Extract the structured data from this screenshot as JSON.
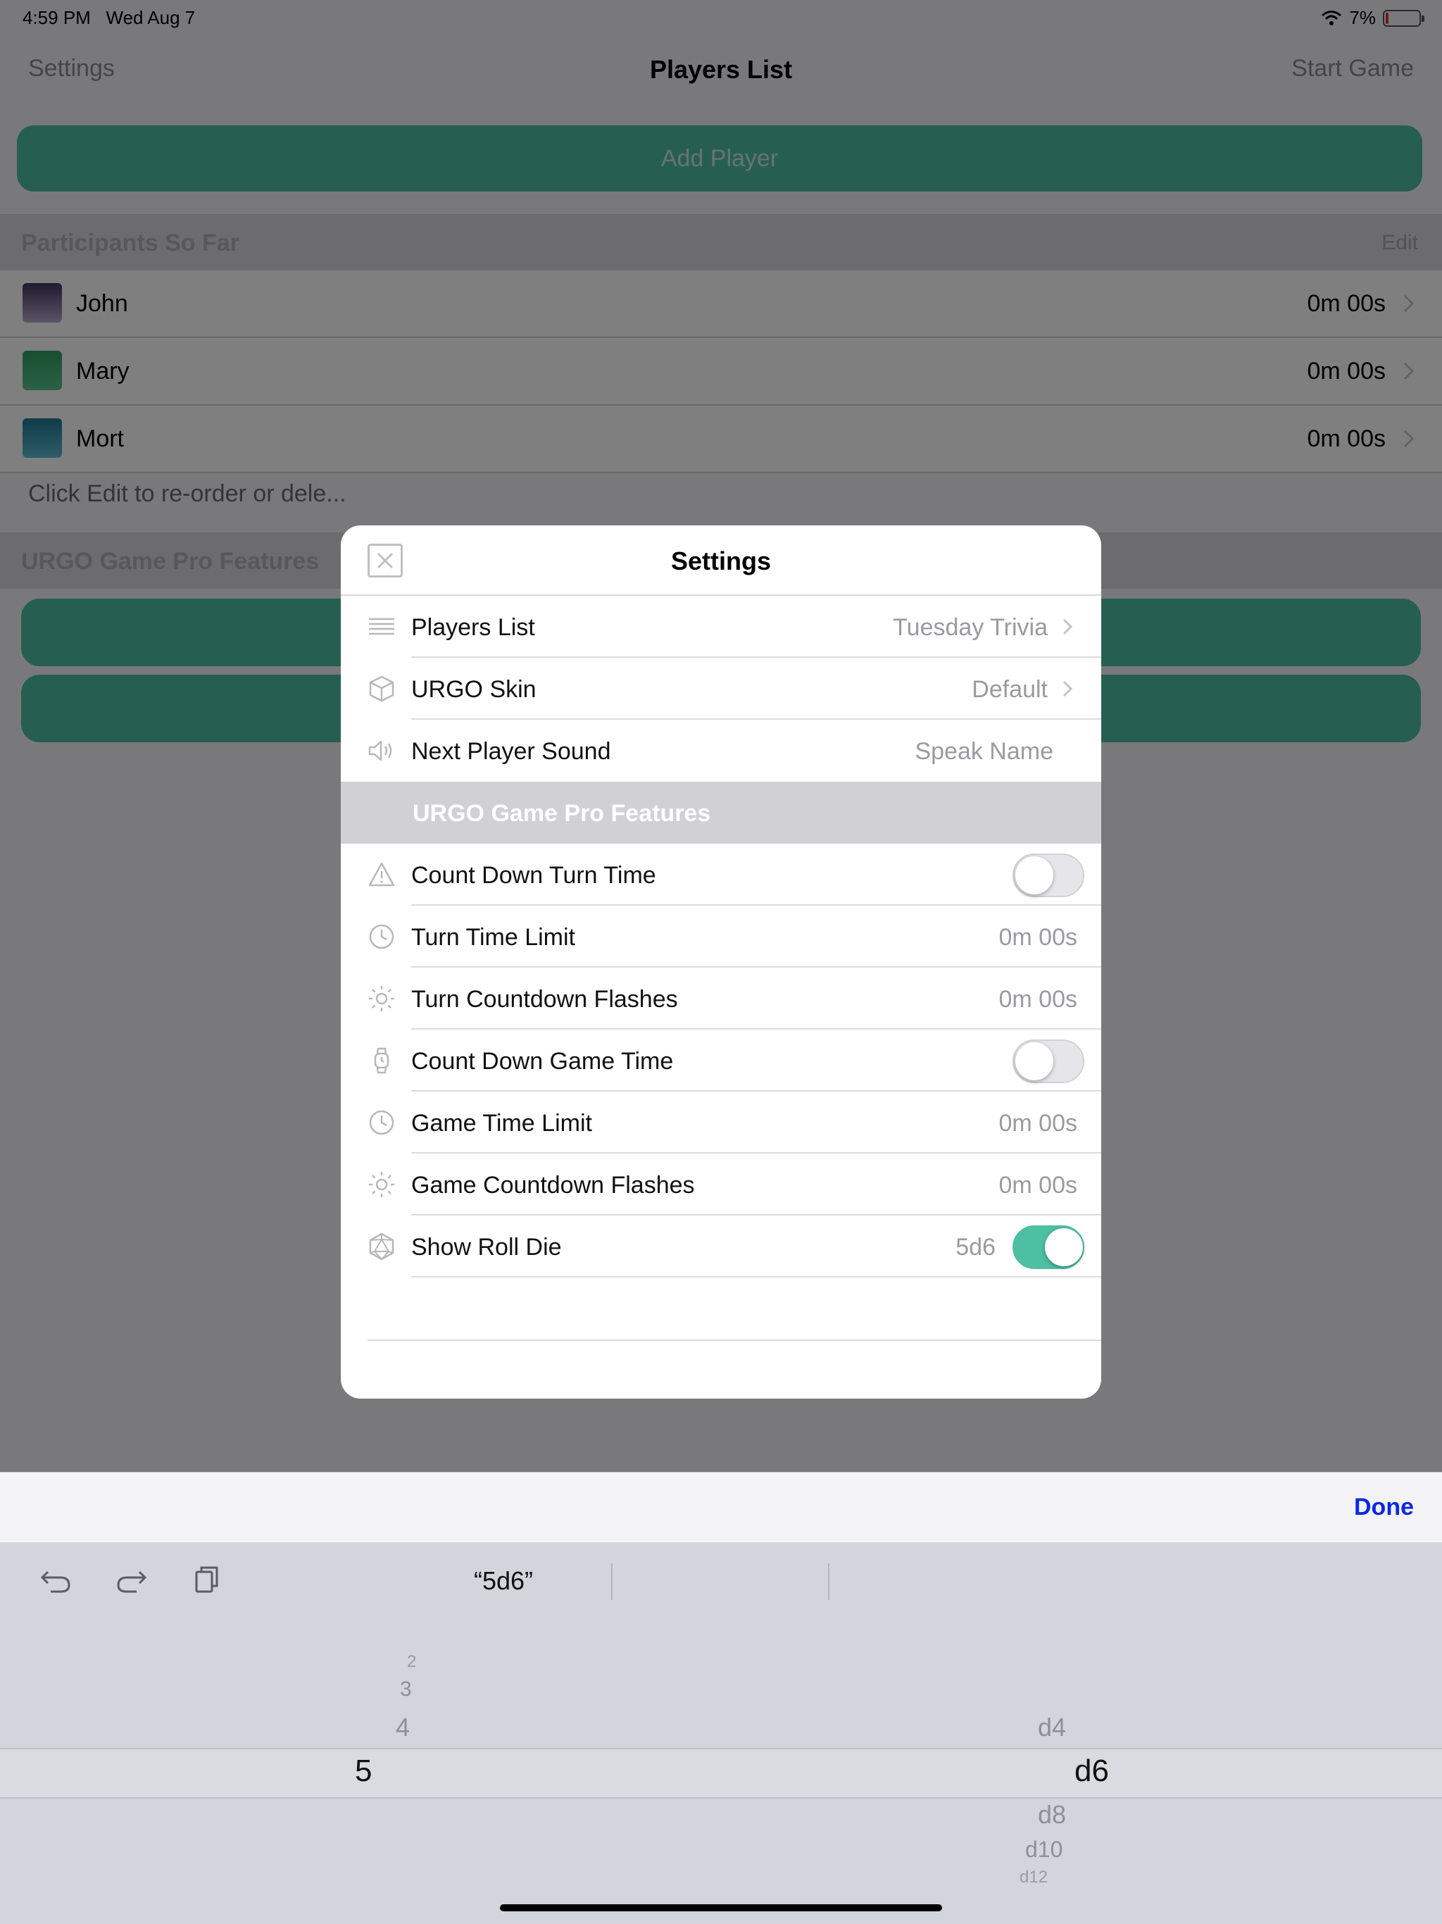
{
  "status_bar": {
    "time": "4:59 PM",
    "date": "Wed Aug 7",
    "battery": "7%"
  },
  "navbar": {
    "left": "Settings",
    "title": "Players List",
    "right": "Start Game"
  },
  "add_player_label": "Add Player",
  "participants": {
    "header": "Participants So Far",
    "edit_label": "Edit",
    "players": [
      {
        "name": "John",
        "time": "0m 00s",
        "color": "#5b4a7a"
      },
      {
        "name": "Mary",
        "time": "0m 00s",
        "color": "#3fae72"
      },
      {
        "name": "Mort",
        "time": "0m 00s",
        "color": "#2f8fa8"
      }
    ],
    "hint": "Click Edit to re-order or dele..."
  },
  "pro_section_title": "URGO Game Pro Features",
  "colors": {
    "accent": "#4dbfa3",
    "done_blue": "#0a28e8"
  },
  "settings_modal": {
    "title": "Settings",
    "rows": [
      {
        "label": "Players List",
        "value": "Tuesday Trivia",
        "icon": "list-icon"
      },
      {
        "label": "URGO Skin",
        "value": "Default",
        "icon": "cube-icon"
      },
      {
        "label": "Next Player Sound",
        "value": "Speak Name",
        "icon": "speaker-icon"
      }
    ],
    "pro_header": "URGO Game Pro Features",
    "pro_rows": [
      {
        "label": "Count Down Turn Time",
        "toggle_on": false,
        "icon": "warning-icon"
      },
      {
        "label": "Turn Time Limit",
        "value": "0m 00s",
        "icon": "clock-icon"
      },
      {
        "label": "Turn Countdown Flashes",
        "value": "0m 00s",
        "icon": "sun-icon"
      },
      {
        "label": "Count Down Game Time",
        "toggle_on": false,
        "icon": "watch-icon"
      },
      {
        "label": "Game Time Limit",
        "value": "0m 00s",
        "icon": "clock-icon"
      },
      {
        "label": "Game Countdown Flashes",
        "value": "0m 00s",
        "icon": "sun-icon"
      },
      {
        "label": "Show Roll Die",
        "value": "5d6",
        "toggle_on": true,
        "icon": "die-icon"
      }
    ]
  },
  "keyboard": {
    "done_label": "Done",
    "suggestion": "“5d6”",
    "picker_count": [
      "2",
      "3",
      "4",
      "5"
    ],
    "picker_count_selected": "5",
    "picker_die": [
      "d4",
      "d6",
      "d8",
      "d10",
      "d12"
    ],
    "picker_die_selected": "d6"
  }
}
